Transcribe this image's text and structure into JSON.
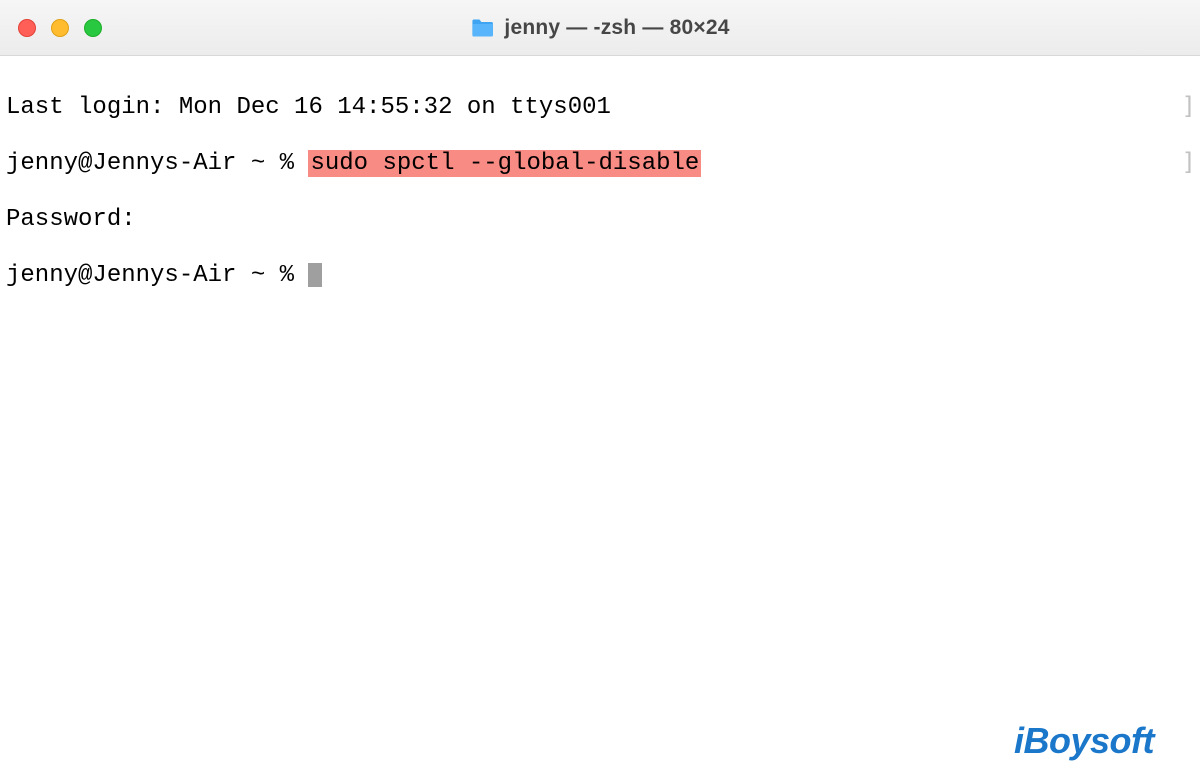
{
  "titlebar": {
    "title": "jenny — -zsh — 80×24",
    "folder_icon": "folder-icon"
  },
  "terminal": {
    "last_login": "Last login: Mon Dec 16 14:55:32 on ttys001",
    "prompt1_prefix": "jenny@Jennys-Air ~ % ",
    "command": "sudo spctl --global-disable",
    "password_line": "Password:",
    "prompt2": "jenny@Jennys-Air ~ % "
  },
  "brackets": {
    "b1": "]",
    "b2": "]"
  },
  "watermark": "iBoysoft"
}
